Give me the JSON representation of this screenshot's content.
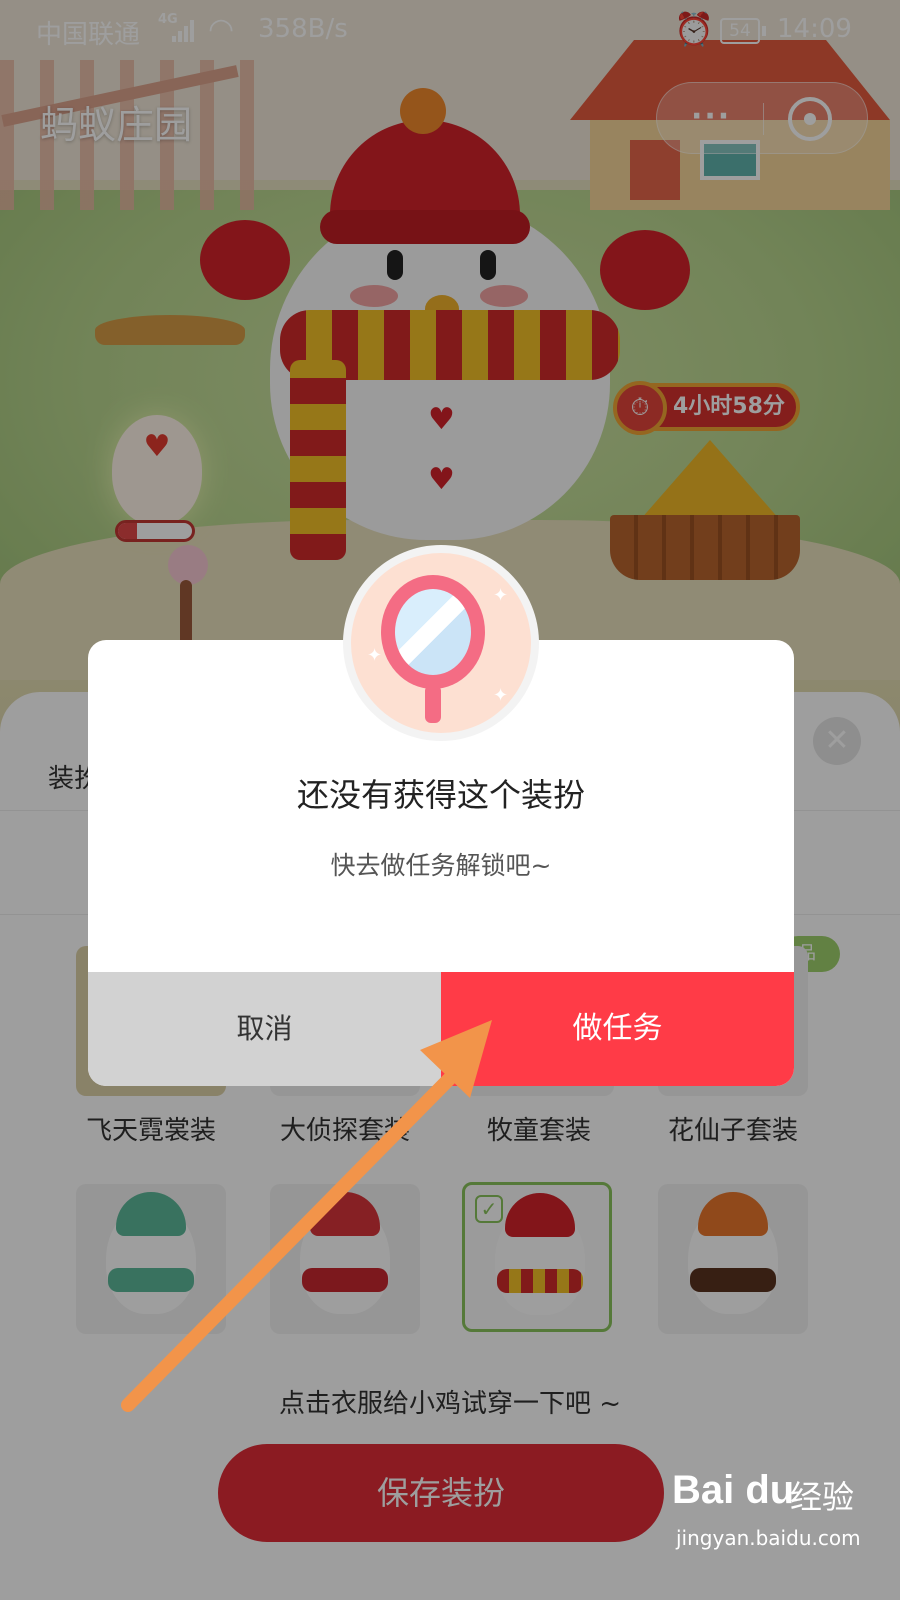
{
  "status_bar": {
    "carrier": "中国联通",
    "network": "4G",
    "speed": "358B/s",
    "battery": "54",
    "time": "14:09"
  },
  "header": {
    "title": "蚂蚁庄园",
    "more_icon": "ellipsis-icon",
    "close_icon": "mini-program-close-icon"
  },
  "scene": {
    "timer": "4小时58分",
    "egg_progress": "26%",
    "egg_progress_value": 0.26
  },
  "sheet": {
    "title": "装扮",
    "new_badge": "品",
    "outfits_row1": [
      {
        "label": "飞天霓裳装"
      },
      {
        "label": "大侦探套装"
      },
      {
        "label": "牧童套装"
      },
      {
        "label": "花仙子套装"
      }
    ],
    "outfits_row2": [
      {
        "label": "",
        "selected": false
      },
      {
        "label": "",
        "selected": false
      },
      {
        "label": "",
        "selected": true
      },
      {
        "label": "",
        "selected": false
      }
    ],
    "hint": "点击衣服给小鸡试穿一下吧 ~",
    "save_label": "保存装扮"
  },
  "dialog": {
    "title": "还没有获得这个装扮",
    "message": "快去做任务解锁吧~",
    "cancel_label": "取消",
    "task_label": "做任务",
    "icon": "mirror-icon"
  },
  "watermark": {
    "logo": "Bai du",
    "jingyan": "经验",
    "url": "jingyan.baidu.com"
  },
  "colors": {
    "accent_red": "#ff3b47",
    "cancel_gray": "#d2d2d2",
    "arrow_orange": "#f2944a"
  }
}
